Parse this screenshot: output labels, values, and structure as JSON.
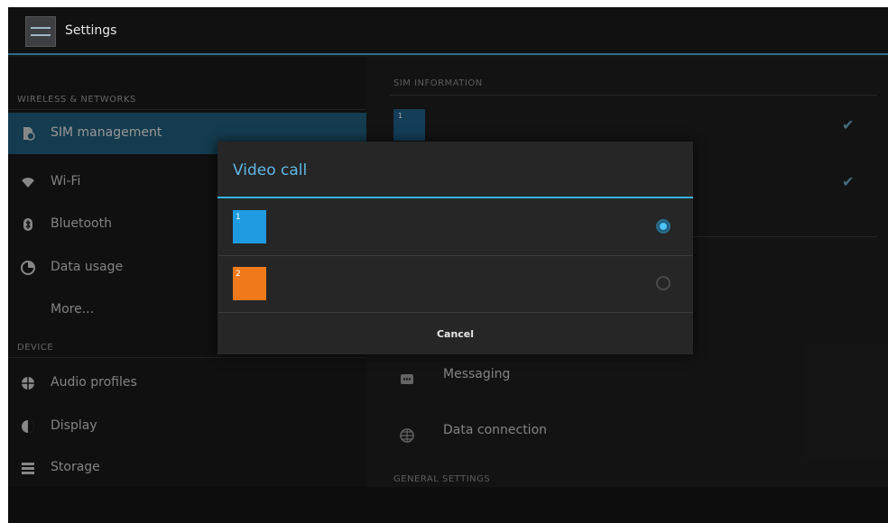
{
  "app": {
    "title": "Settings"
  },
  "sidebar": {
    "section_wireless": "WIRELESS & NETWORKS",
    "section_device": "DEVICE",
    "items": [
      {
        "label": "SIM management",
        "icon": "sim-card-icon",
        "active": true
      },
      {
        "label": "Wi-Fi",
        "icon": "wifi-icon"
      },
      {
        "label": "Bluetooth",
        "icon": "bluetooth-icon"
      },
      {
        "label": "Data usage",
        "icon": "data-usage-icon"
      },
      {
        "label": "More..."
      },
      {
        "label": "Audio profiles",
        "icon": "audio-profiles-icon"
      },
      {
        "label": "Display",
        "icon": "display-icon"
      },
      {
        "label": "Storage",
        "icon": "storage-icon"
      }
    ]
  },
  "detail": {
    "section_sim_info": "SIM INFORMATION",
    "section_general": "GENERAL SETTINGS",
    "sim1_label": "1",
    "items": [
      {
        "label": "Messaging",
        "icon": "messaging-icon"
      },
      {
        "label": "Data connection",
        "icon": "globe-icon"
      }
    ]
  },
  "dialog": {
    "title": "Video call",
    "options": [
      {
        "badge": "1",
        "color": "#1e9be0",
        "selected": true
      },
      {
        "badge": "2",
        "color": "#f07a1a",
        "selected": false
      }
    ],
    "cancel_label": "Cancel"
  },
  "colors": {
    "accent": "#33b5e5",
    "selected_bg": "#1f5b78",
    "sim1": "#1e9be0",
    "sim2": "#f07a1a"
  }
}
